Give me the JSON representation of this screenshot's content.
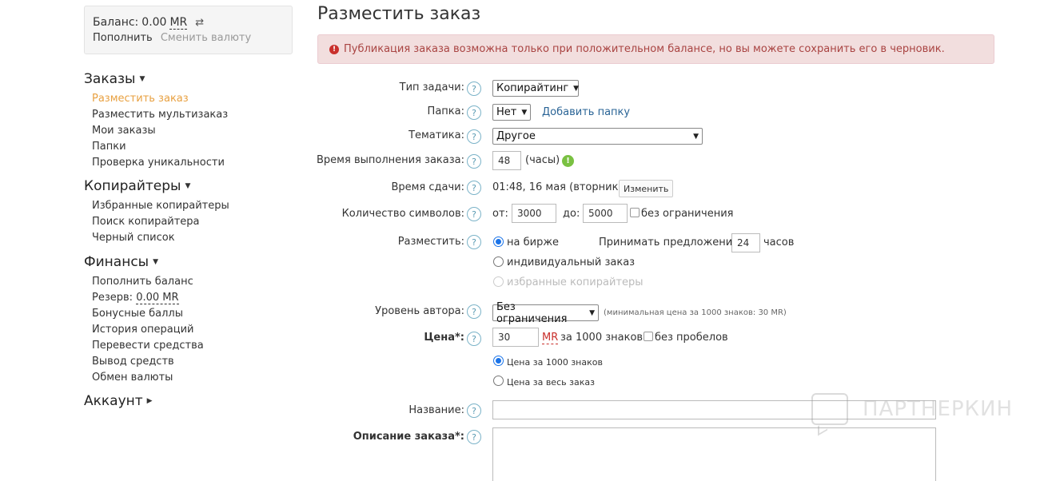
{
  "sidebar": {
    "balance_label": "Баланс:",
    "balance_amount": "0.00",
    "balance_currency": "MR",
    "topup": "Пополнить",
    "change_currency": "Сменить валюту",
    "sections": [
      {
        "title": "Заказы",
        "items": [
          "Разместить заказ",
          "Разместить мультизаказ",
          "Мои заказы",
          "Папки",
          "Проверка уникальности"
        ]
      },
      {
        "title": "Копирайтеры",
        "items": [
          "Избранные копирайтеры",
          "Поиск копирайтера",
          "Черный список"
        ]
      },
      {
        "title": "Финансы",
        "items": [
          "Пополнить баланс",
          "Резерв:",
          "Бонусные баллы",
          "История операций",
          "Перевести средства",
          "Вывод средств",
          "Обмен валюты"
        ]
      },
      {
        "title": "Аккаунт",
        "items": []
      }
    ],
    "reserve_amount": "0.00 MR"
  },
  "main": {
    "title": "Разместить заказ",
    "alert": "Публикация заказа возможна только при положительном балансе, но вы можете сохранить его в черновик.",
    "labels": {
      "task_type": "Тип задачи:",
      "folder": "Папка:",
      "topic": "Тематика:",
      "duration": "Время выполнения заказа:",
      "deadline": "Время сдачи:",
      "chars": "Количество символов:",
      "place": "Разместить:",
      "level": "Уровень автора:",
      "price": "Цена*:",
      "name": "Название:",
      "description": "Описание заказа*:"
    },
    "task_type_value": "Копирайтинг",
    "folder_value": "Нет",
    "add_folder": "Добавить папку",
    "topic_value": "Другое",
    "duration_value": "48",
    "duration_unit": "(часы)",
    "deadline_value": "01:48, 16 мая (вторник)",
    "change_button": "Изменить",
    "chars_from_label": "от:",
    "chars_from": "3000",
    "chars_to_label": "до:",
    "chars_to": "5000",
    "chars_unlimited": "без ограничения",
    "place_exchange": "на бирже",
    "accept_offers": "Принимать предложения",
    "accept_hours": "24",
    "hours_label": "часов",
    "place_individual": "индивидуальный заказ",
    "place_favorites": "избранные копирайтеры",
    "level_value": "Без ограничения",
    "level_note": "(минимальная цена за 1000 знаков: 30 MR)",
    "price_value": "30",
    "price_currency": "MR",
    "price_per": "за 1000 знаков",
    "no_spaces": "без пробелов",
    "price_per_1000": "Цена за 1000 знаков",
    "price_whole": "Цена за весь заказ"
  },
  "watermark": "ПАРТНЕРКИН",
  "help_glyph": "?"
}
